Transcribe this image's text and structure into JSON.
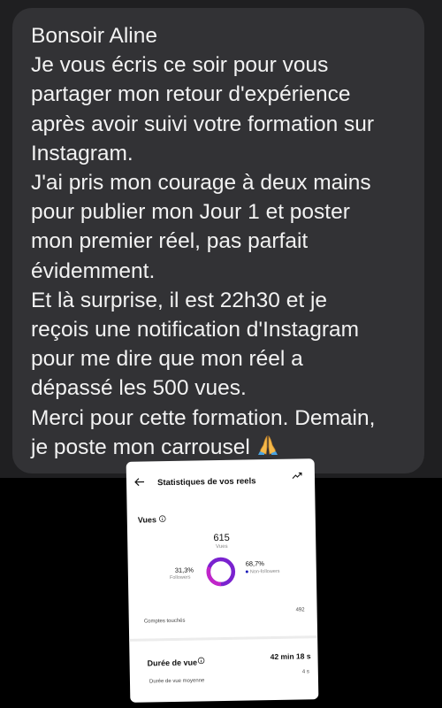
{
  "message": {
    "greeting": "Bonsoir Aline",
    "paragraphs": [
      [
        "Je vous écris ce soir pour vous",
        "partager mon retour d'expérience",
        "après avoir suivi votre formation sur",
        "Instagram."
      ],
      [
        "J'ai pris mon courage à deux mains",
        "pour publier mon Jour 1 et poster",
        "mon premier réel, pas parfait",
        "évidemment."
      ],
      [
        "Et là surprise, il est 22h30 et je",
        "reçois une notification d'Instagram",
        "pour me dire que mon réel a",
        "dépassé les 500 vues."
      ],
      [
        "Merci pour cette formation. Demain,",
        "je poste mon carrousel"
      ]
    ],
    "emoji": "folded-hands-emoji",
    "colors": {
      "panel": "#1f1f21",
      "bubble": "#323235",
      "text": "#f2f2f2"
    }
  },
  "stats": {
    "title": "Statistiques de vos reels",
    "views": {
      "label": "Vues",
      "total": "615",
      "total_label": "Vues",
      "followers_pct": "31,3%",
      "followers_label": "Followers",
      "followers_fraction": 0.313,
      "non_followers_pct": "68,7%",
      "non_followers_label": "Non-followers",
      "colors": {
        "followers": "#c125c9",
        "non_followers": "#3b1fd1"
      }
    },
    "accounts_reached": {
      "label": "Comptes touchés",
      "value": "492"
    },
    "watch_time": {
      "label": "Durée de vue",
      "total": "42 min 18 s",
      "average_label": "Durée de vue moyenne",
      "average": "4 s"
    }
  }
}
